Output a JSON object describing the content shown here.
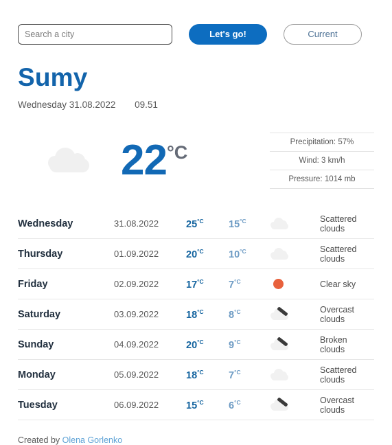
{
  "search": {
    "placeholder": "Search a city",
    "value": "",
    "go_label": "Let's go!",
    "current_label": "Current"
  },
  "location": {
    "city": "Sumy",
    "date": "Wednesday 31.08.2022",
    "time": "09.51"
  },
  "current": {
    "icon": "cloud-icon",
    "temperature": "22",
    "unit": "°C",
    "precipitation": "Precipitation: 57%",
    "wind": "Wind: 3 km/h",
    "pressure": "Pressure: 1014 mb"
  },
  "forecast": [
    {
      "day": "Wednesday",
      "date": "31.08.2022",
      "max": "25",
      "min": "15",
      "unit": "°C",
      "icon": "scattered-clouds-icon",
      "description": "Scattered clouds"
    },
    {
      "day": "Thursday",
      "date": "01.09.2022",
      "max": "20",
      "min": "10",
      "unit": "°C",
      "icon": "scattered-clouds-icon",
      "description": "Scattered clouds"
    },
    {
      "day": "Friday",
      "date": "02.09.2022",
      "max": "17",
      "min": "7",
      "unit": "°C",
      "icon": "clear-sky-icon",
      "description": "Clear sky"
    },
    {
      "day": "Saturday",
      "date": "03.09.2022",
      "max": "18",
      "min": "8",
      "unit": "°C",
      "icon": "overcast-clouds-icon",
      "description": "Overcast clouds"
    },
    {
      "day": "Sunday",
      "date": "04.09.2022",
      "max": "20",
      "min": "9",
      "unit": "°C",
      "icon": "broken-clouds-icon",
      "description": "Broken clouds"
    },
    {
      "day": "Monday",
      "date": "05.09.2022",
      "max": "18",
      "min": "7",
      "unit": "°C",
      "icon": "scattered-clouds-icon",
      "description": "Scattered clouds"
    },
    {
      "day": "Tuesday",
      "date": "06.09.2022",
      "max": "15",
      "min": "6",
      "unit": "°C",
      "icon": "overcast-clouds-icon",
      "description": "Overcast clouds"
    }
  ],
  "footer": {
    "prefix": "Created by ",
    "author": "Olena Gorlenko"
  },
  "colors": {
    "accent_blue": "#0d6dc0",
    "city_blue": "#1364ab",
    "temp_blue": "#1269b5",
    "max_blue": "#14649f",
    "min_blue": "#6d9bc4",
    "sun_orange": "#e8613c",
    "link_blue": "#5fa3d6",
    "cloud_gray": "#f1f1f1"
  }
}
